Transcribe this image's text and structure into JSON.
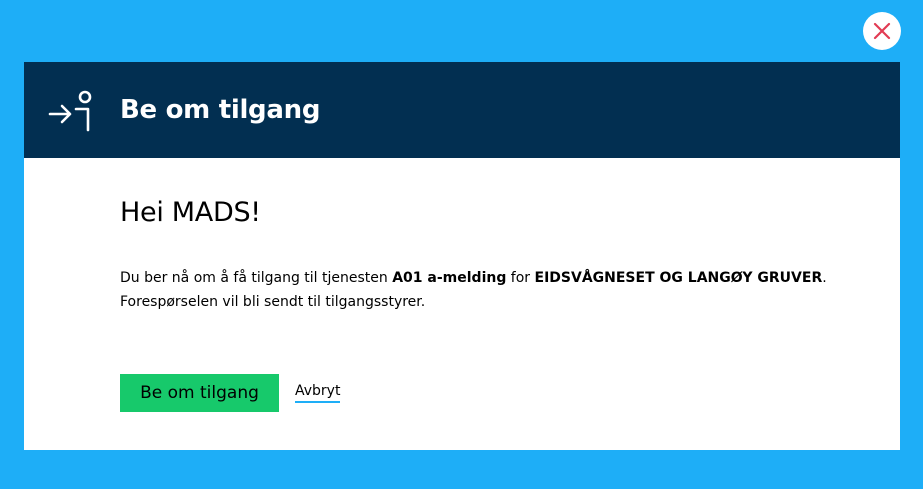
{
  "close_button": {
    "label": "Close",
    "icon": "close-icon",
    "color": "#e23b53"
  },
  "header": {
    "icon": "request-access-icon",
    "title": "Be om tilgang",
    "background": "#022f51"
  },
  "body": {
    "greeting": "Hei MADS!",
    "message": {
      "part1": "Du ber nå om å få tilgang til tjenesten ",
      "service": "A01 a-melding",
      "part2": " for ",
      "organization": "EIDSVÅGNESET OG LANGØY GRUVER",
      "part3": ".",
      "line2": "Forespørselen vil bli sendt til tilgangsstyrer."
    }
  },
  "actions": {
    "confirm_label": "Be om tilgang",
    "confirm_color": "#17c96b",
    "cancel_label": "Avbryt"
  },
  "page_background": "#1eaef7"
}
